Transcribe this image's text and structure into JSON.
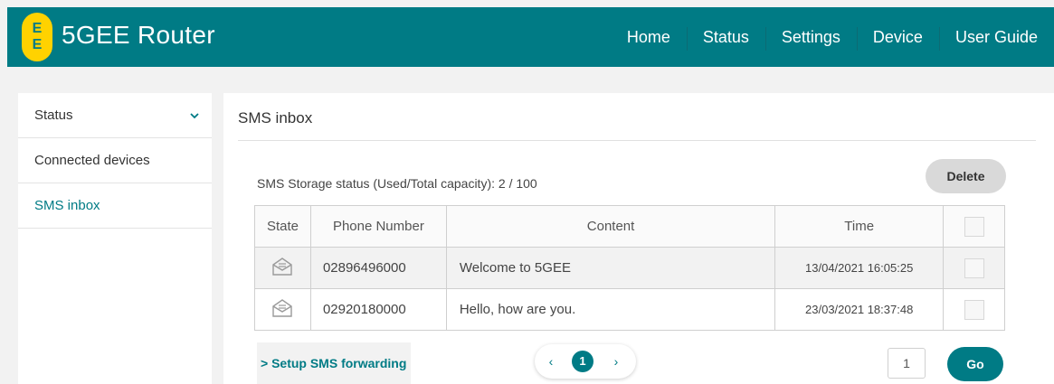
{
  "header": {
    "logo_letters": [
      "E",
      "E"
    ],
    "title": "5GEE Router",
    "nav": [
      "Home",
      "Status",
      "Settings",
      "Device",
      "User Guide"
    ]
  },
  "sidebar": {
    "items": [
      {
        "label": "Status",
        "icon": "chevron-down-icon"
      },
      {
        "label": "Connected devices"
      },
      {
        "label": "SMS inbox",
        "active": true
      }
    ]
  },
  "main": {
    "title": "SMS inbox",
    "storage_status": "SMS Storage status (Used/Total capacity): 2 / 100",
    "delete_label": "Delete",
    "table": {
      "headers": [
        "State",
        "Phone Number",
        "Content",
        "Time"
      ],
      "rows": [
        {
          "state_icon": "envelope-open-icon",
          "phone": "02896496000",
          "content": "Welcome to 5GEE",
          "time": "13/04/2021 16:05:25"
        },
        {
          "state_icon": "envelope-open-icon",
          "phone": "02920180000",
          "content": "Hello, how are you.",
          "time": "23/03/2021 18:37:48"
        }
      ]
    },
    "forwarding_link": "> Setup SMS forwarding",
    "pagination": {
      "prev": "‹",
      "current": "1",
      "next": "›"
    },
    "page_input": "1",
    "go_label": "Go"
  },
  "colors": {
    "brand": "#007b85",
    "logo_yellow": "#ffd200"
  }
}
